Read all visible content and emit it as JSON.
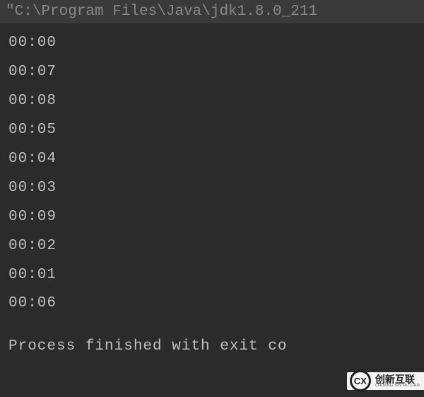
{
  "header": {
    "command": "\"C:\\Program Files\\Java\\jdk1.8.0_211"
  },
  "output": {
    "lines": [
      "00:00",
      "00:07",
      "00:08",
      "00:05",
      "00:04",
      "00:03",
      "00:09",
      "00:02",
      "00:01",
      "00:06"
    ]
  },
  "footer": {
    "status": "Process finished with exit co"
  },
  "watermark": {
    "icon_letters": "CX",
    "main": "创新互联",
    "sub": "CHUANG XIN HU LIAN"
  }
}
